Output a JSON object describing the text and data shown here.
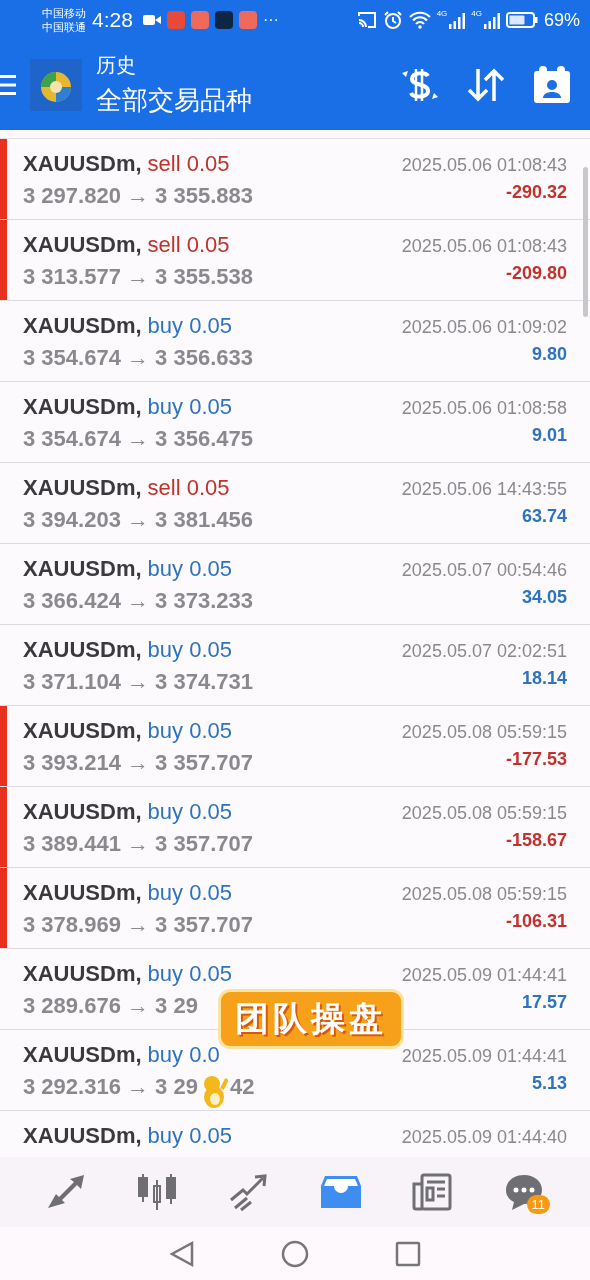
{
  "status_bar": {
    "carriers": [
      "中国移动",
      "中国联通"
    ],
    "time": "4:28",
    "more": "···",
    "network_labels": [
      "4G",
      "4G"
    ],
    "battery": "69%"
  },
  "header": {
    "title": "历史",
    "subtitle": "全部交易品种"
  },
  "trades": [
    {
      "symbol": "XAUUSDm,",
      "trade": "sell 0.05",
      "kind": "sell",
      "price": "3 297.820 → 3 355.883",
      "time": "2025.05.06 01:08:43",
      "profit": "-290.32",
      "loss": true
    },
    {
      "symbol": "XAUUSDm,",
      "trade": "sell 0.05",
      "kind": "sell",
      "price": "3 313.577 → 3 355.538",
      "time": "2025.05.06 01:08:43",
      "profit": "-209.80",
      "loss": true
    },
    {
      "symbol": "XAUUSDm,",
      "trade": "buy 0.05",
      "kind": "buy",
      "price": "3 354.674 → 3 356.633",
      "time": "2025.05.06 01:09:02",
      "profit": "9.80",
      "loss": false
    },
    {
      "symbol": "XAUUSDm,",
      "trade": "buy 0.05",
      "kind": "buy",
      "price": "3 354.674 → 3 356.475",
      "time": "2025.05.06 01:08:58",
      "profit": "9.01",
      "loss": false
    },
    {
      "symbol": "XAUUSDm,",
      "trade": "sell 0.05",
      "kind": "sell",
      "price": "3 394.203 → 3 381.456",
      "time": "2025.05.06 14:43:55",
      "profit": "63.74",
      "loss": false
    },
    {
      "symbol": "XAUUSDm,",
      "trade": "buy 0.05",
      "kind": "buy",
      "price": "3 366.424 → 3 373.233",
      "time": "2025.05.07 00:54:46",
      "profit": "34.05",
      "loss": false
    },
    {
      "symbol": "XAUUSDm,",
      "trade": "buy 0.05",
      "kind": "buy",
      "price": "3 371.104 → 3 374.731",
      "time": "2025.05.07 02:02:51",
      "profit": "18.14",
      "loss": false
    },
    {
      "symbol": "XAUUSDm,",
      "trade": "buy 0.05",
      "kind": "buy",
      "price": "3 393.214 → 3 357.707",
      "time": "2025.05.08 05:59:15",
      "profit": "-177.53",
      "loss": true
    },
    {
      "symbol": "XAUUSDm,",
      "trade": "buy 0.05",
      "kind": "buy",
      "price": "3 389.441 → 3 357.707",
      "time": "2025.05.08 05:59:15",
      "profit": "-158.67",
      "loss": true
    },
    {
      "symbol": "XAUUSDm,",
      "trade": "buy 0.05",
      "kind": "buy",
      "price": "3 378.969 → 3 357.707",
      "time": "2025.05.08 05:59:15",
      "profit": "-106.31",
      "loss": true
    },
    {
      "symbol": "XAUUSDm,",
      "trade": "buy 0.05",
      "kind": "buy",
      "price": "3 289.676 → 3 29",
      "time": "2025.05.09 01:44:41",
      "profit": "17.57",
      "loss": false
    },
    {
      "symbol": "XAUUSDm,",
      "trade": "buy 0.0",
      "kind": "buy",
      "price": "3 292.316 → 3 29",
      "price_tail": "42",
      "time": "2025.05.09 01:44:41",
      "profit": "5.13",
      "loss": false
    },
    {
      "symbol": "XAUUSDm,",
      "trade": "buy 0.05",
      "kind": "buy",
      "time": "2025.05.09 01:44:40",
      "loss": false
    }
  ],
  "sticker": {
    "caption": "团队操盘"
  },
  "bottom_tabs": [
    {
      "kind": "trade",
      "selected": false
    },
    {
      "kind": "quotes",
      "selected": false
    },
    {
      "kind": "chart",
      "selected": false
    },
    {
      "kind": "history",
      "selected": true
    },
    {
      "kind": "news",
      "selected": false
    },
    {
      "kind": "chat",
      "selected": false,
      "badge": "11"
    }
  ]
}
